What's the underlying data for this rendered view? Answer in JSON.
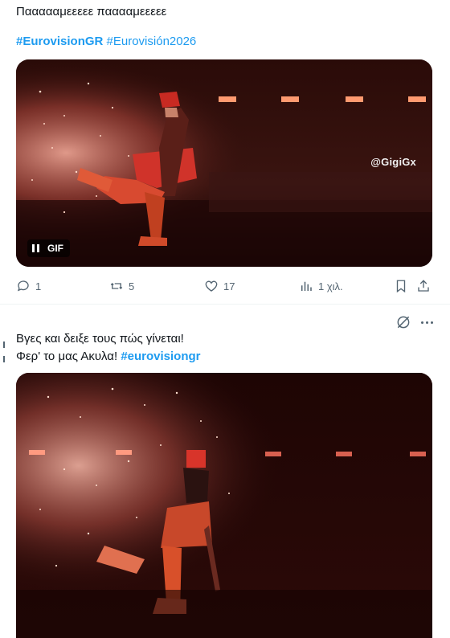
{
  "tweet1": {
    "text": "Παααααμεεεεε πααααμεεεεε",
    "hashtag1": "#EurovisionGR",
    "hashtag2": "#Eurovisión2026",
    "media": {
      "badge": "GIF",
      "watermark": "@GigiGx"
    },
    "actions": {
      "replies": "1",
      "reposts": "5",
      "likes": "17",
      "views": "1 χιλ."
    }
  },
  "tweet2": {
    "line1": "Βγες και δειξε τους πώς γίνεται!",
    "line2_text": "Φερ' το μας Ακυλα! ",
    "hashtag": "#eurovisiongr"
  },
  "icons": {
    "reply": "reply-icon",
    "repost": "repost-icon",
    "like": "heart-icon",
    "views": "views-icon",
    "bookmark": "bookmark-icon",
    "share": "share-icon",
    "grok": "grok-icon",
    "more": "more-icon"
  },
  "colors": {
    "hashtag": "#1d9bf0",
    "secondary_text": "#536471"
  }
}
